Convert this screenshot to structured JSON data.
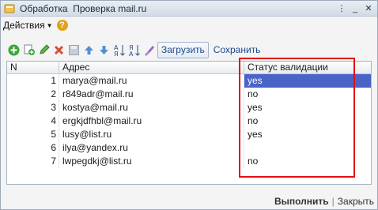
{
  "window": {
    "title": "Обработка  Проверка mail.ru",
    "controls": [
      "more-icon",
      "minimize-icon",
      "close-icon"
    ]
  },
  "actionbar": {
    "actions_label": "Действия",
    "help_label": "?"
  },
  "toolbar": {
    "icons": [
      "add-icon",
      "copy-icon",
      "edit-icon",
      "delete-icon",
      "save-disk-icon",
      "move-up-icon",
      "move-down-icon",
      "sort-asc-icon",
      "sort-desc-icon",
      "clear-icon"
    ],
    "load_label": "Загрузить",
    "save_label": "Сохранить"
  },
  "table": {
    "headers": {
      "n": "N",
      "address": "Адрес",
      "status": "Статус валидации"
    },
    "rows": [
      {
        "n": "1",
        "address": "marya@mail.ru",
        "status": "yes"
      },
      {
        "n": "2",
        "address": "r849adr@mail.ru",
        "status": "no"
      },
      {
        "n": "3",
        "address": "kostya@mail.ru",
        "status": "yes"
      },
      {
        "n": "4",
        "address": "ergkjdfhbl@mail.ru",
        "status": "no"
      },
      {
        "n": "5",
        "address": "lusy@list.ru",
        "status": "yes"
      },
      {
        "n": "6",
        "address": "ilya@yandex.ru",
        "status": ""
      },
      {
        "n": "7",
        "address": "lwpegdkj@list.ru",
        "status": "no"
      }
    ]
  },
  "footer": {
    "run_label": "Выполнить",
    "separator": "|",
    "close_label": "Закрыть"
  },
  "colors": {
    "selection": "#4a63c7",
    "highlight": "#e01010",
    "help": "#e0a21a"
  }
}
